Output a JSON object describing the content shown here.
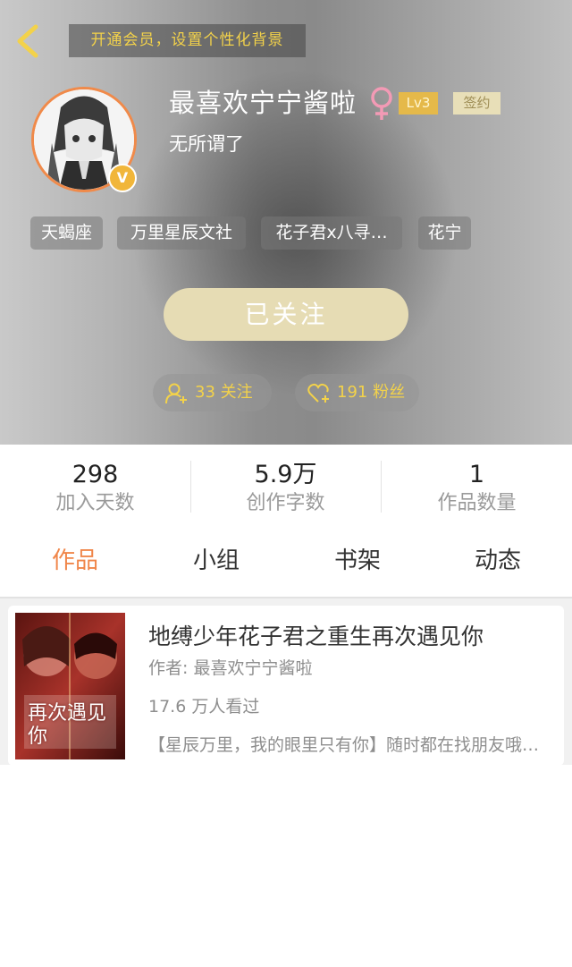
{
  "header": {
    "vip_banner": "开通会员，设置个性化背景",
    "username": "最喜欢宁宁酱啦",
    "level": "Lv3",
    "sign_badge": "签约",
    "bio": "无所谓了",
    "vip_mark": "V",
    "tags": [
      "天蝎座",
      "万里星辰文社",
      "花子君x八寻…",
      "花宁"
    ],
    "follow_button": "已关注",
    "following_count": "33 关注",
    "fans_count": "191 粉丝"
  },
  "stats": [
    {
      "value": "298",
      "label": "加入天数"
    },
    {
      "value": "5.9万",
      "label": "创作字数"
    },
    {
      "value": "1",
      "label": "作品数量"
    }
  ],
  "tabs": [
    "作品",
    "小组",
    "书架",
    "动态"
  ],
  "active_tab": "作品",
  "works": [
    {
      "title": "地缚少年花子君之重生再次遇见你",
      "author": "作者: 最喜欢宁宁酱啦",
      "views": "17.6 万人看过",
      "description": "【星辰万里，我的眼里只有你】随时都在找朋友哦…",
      "cover_text": "再次遇见你"
    }
  ],
  "colors": {
    "accent_orange": "#f0864a",
    "gold": "#f3d24a",
    "follow_button_bg": "#e6dcb4",
    "gender_pink": "#f39ab5"
  }
}
